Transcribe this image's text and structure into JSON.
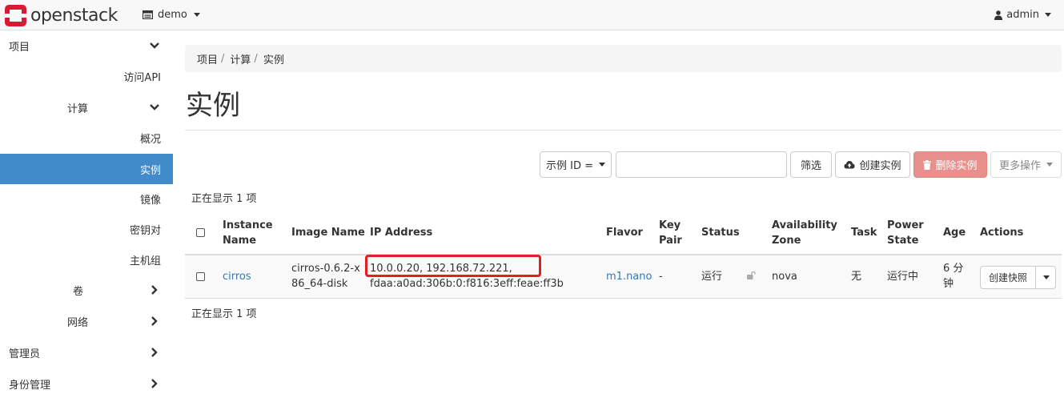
{
  "navbar": {
    "brand": "openstack",
    "project": "demo",
    "user": "admin"
  },
  "sidebar": {
    "project": "项目",
    "api_access": "访问API",
    "compute": "计算",
    "overview": "概况",
    "instances": "实例",
    "images": "镜像",
    "key_pairs": "密钥对",
    "server_groups": "主机组",
    "volumes": "卷",
    "network": "网络",
    "admin": "管理员",
    "identity": "身份管理"
  },
  "breadcrumb": [
    "项目",
    "计算",
    "实例"
  ],
  "page_title": "实例",
  "toolbar": {
    "filter_select": "示例 ID =",
    "filter_value": "",
    "filter_button": "筛选",
    "create_button": "创建实例",
    "delete_button": "删除实例",
    "more_button": "更多操作"
  },
  "count_text": "正在显示 1 项",
  "table": {
    "headers": {
      "instance_name": [
        "Instance",
        "Name"
      ],
      "image_name": "Image Name",
      "ip_address": "IP Address",
      "flavor": "Flavor",
      "key_pair": [
        "Key",
        "Pair"
      ],
      "status": "Status",
      "availability_zone": [
        "Availability",
        "Zone"
      ],
      "task": "Task",
      "power_state": [
        "Power",
        "State"
      ],
      "age": "Age",
      "actions": "Actions"
    },
    "rows": [
      {
        "name": "cirros",
        "image": [
          "cirros-0.6.2-x",
          "86_64-disk"
        ],
        "ip": [
          "10.0.0.20, 192.168.72.221,",
          "fdaa:a0ad:306b:0:f816:3eff:feae:ff3b"
        ],
        "flavor": "m1.nano",
        "key_pair": "-",
        "status": "运行",
        "zone": "nova",
        "task": "无",
        "power_state": "运行中",
        "age": [
          "6 分",
          "钟"
        ],
        "action": "创建快照"
      }
    ]
  },
  "colors": {
    "active_nav": "#428bca",
    "link": "#337ab7",
    "danger": "#e8908c",
    "highlight": "#e02020",
    "brand": "#da1a32"
  }
}
